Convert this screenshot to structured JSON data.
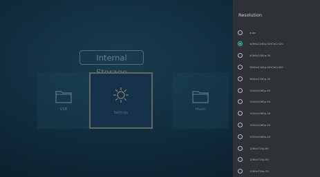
{
  "background": {
    "storage_title": "Internal Storage",
    "tiles": [
      {
        "label": "USB",
        "icon": "folder-icon"
      },
      {
        "label": "Settings",
        "icon": "gear-icon"
      },
      {
        "label": "Music",
        "icon": "folder-icon"
      }
    ]
  },
  "resolution_panel": {
    "title": "Resolution",
    "selected_index": 1,
    "accent_color": "#2fc4a6",
    "options": [
      "auto",
      "4096x2160p-50YCbCr420",
      "4096x2160p-30",
      "3840x2160p-50YCbCr420",
      "3840x2160p-30",
      "1920x1080p-60",
      "1920x1080p-50",
      "1920x1080p-30",
      "1920x1080p-25",
      "1920x1080p-24",
      "1280x720p-60",
      "1280x720p-50",
      "1280x720p-30"
    ]
  }
}
